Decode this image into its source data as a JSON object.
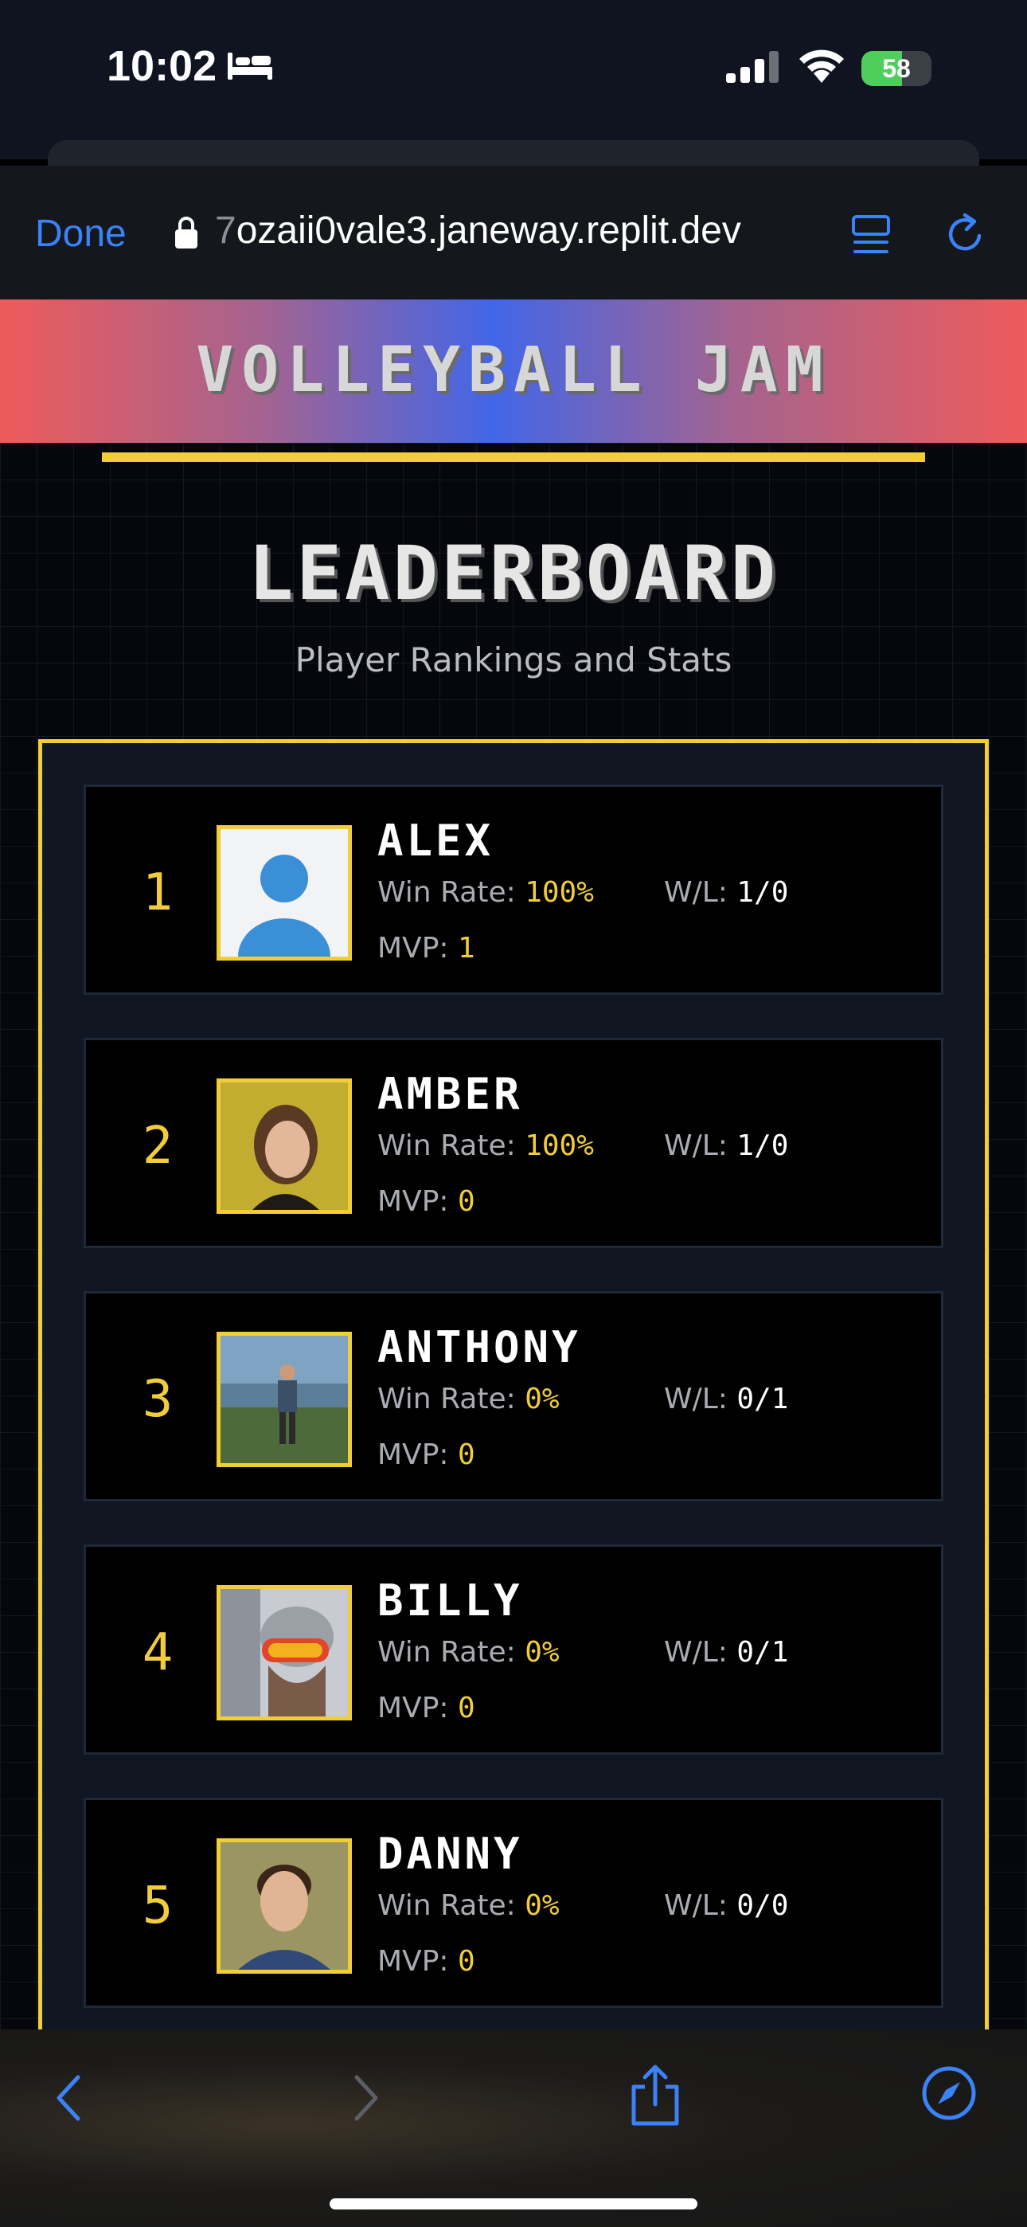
{
  "status_bar": {
    "time": "10:02",
    "battery_level": "58",
    "battery_fraction": 0.58
  },
  "browser": {
    "done_label": "Done",
    "url_prefix": "7",
    "url_rest": "ozaii0vale3.janeway.replit.dev"
  },
  "banner": {
    "title": "VOLLEYBALL JAM"
  },
  "leaderboard": {
    "title": "LEADERBOARD",
    "subtitle": "Player Rankings and Stats",
    "labels": {
      "win_rate": "Win Rate:",
      "wl": "W/L:",
      "mvp": "MVP:"
    },
    "players": [
      {
        "rank": "1",
        "name": "ALEX",
        "win_rate": "100%",
        "wl": "1/0",
        "mvp": "1",
        "avatar": "default-avatar"
      },
      {
        "rank": "2",
        "name": "AMBER",
        "win_rate": "100%",
        "wl": "1/0",
        "mvp": "0",
        "avatar": "photo"
      },
      {
        "rank": "3",
        "name": "ANTHONY",
        "win_rate": "0%",
        "wl": "0/1",
        "mvp": "0",
        "avatar": "photo"
      },
      {
        "rank": "4",
        "name": "BILLY",
        "win_rate": "0%",
        "wl": "0/1",
        "mvp": "0",
        "avatar": "photo"
      },
      {
        "rank": "5",
        "name": "DANNY",
        "win_rate": "0%",
        "wl": "0/0",
        "mvp": "0",
        "avatar": "photo"
      }
    ]
  },
  "colors": {
    "accent": "#f2cd3a",
    "link": "#3b82f6",
    "banner_mid": "#4266e8",
    "banner_edge": "#ee5b5b"
  }
}
